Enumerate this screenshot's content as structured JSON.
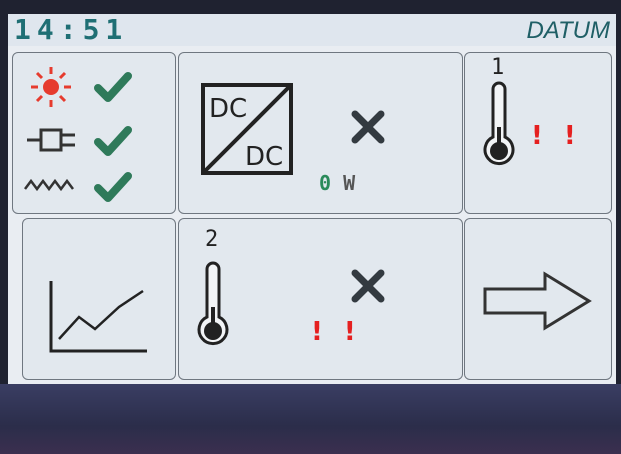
{
  "header": {
    "time": "14:51",
    "title": "DATUM"
  },
  "status_tile": {
    "items": [
      {
        "icon": "sun-icon",
        "state": "check-icon"
      },
      {
        "icon": "plug-icon",
        "state": "check-icon"
      },
      {
        "icon": "zigzag-wave-icon",
        "state": "check-icon"
      }
    ]
  },
  "dcdc_tile": {
    "label_top": "DC",
    "label_bottom": "DC",
    "status": "cross-icon",
    "power_value": "0",
    "power_unit": "W"
  },
  "temp1_tile": {
    "sensor_number": "1",
    "alert": "! !"
  },
  "chart_tile": {
    "icon": "line-chart-icon"
  },
  "temp2_tile": {
    "sensor_number": "2",
    "status": "cross-icon",
    "alert": "! !"
  },
  "next_tile": {
    "icon": "arrow-right-icon"
  },
  "colors": {
    "check": "#2f7a5a",
    "alert": "#e52020",
    "cross": "#333a40",
    "sun": "#e63b2e",
    "clock": "#1f6f74"
  }
}
